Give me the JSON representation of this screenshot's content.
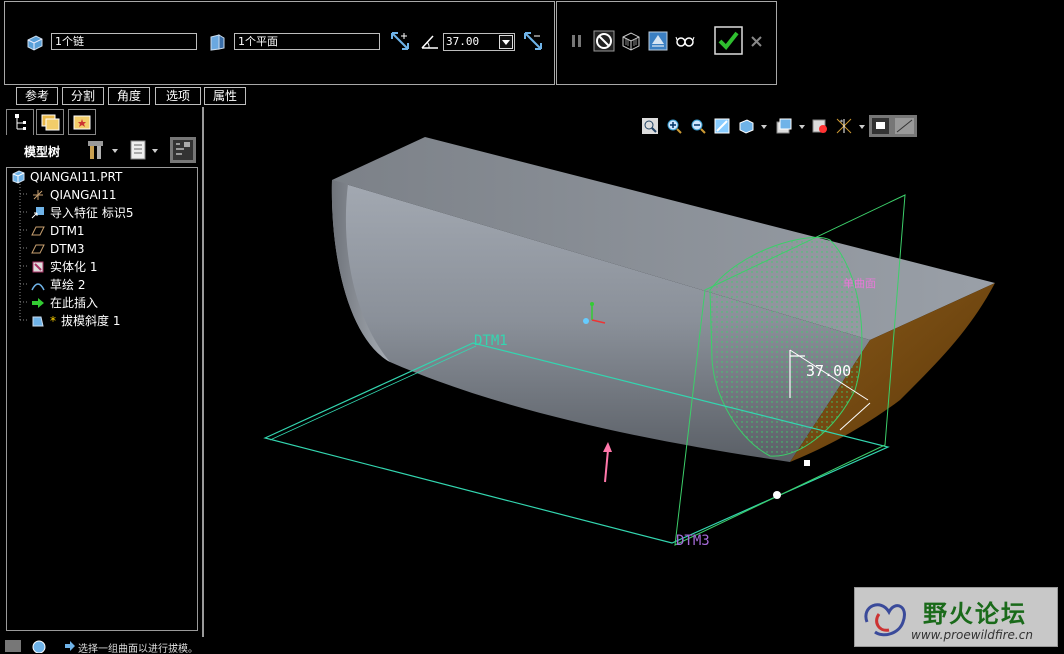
{
  "dashboard": {
    "chain_field": "1个链",
    "plane_field": "1个平面",
    "angle_value": "37.00"
  },
  "tabs": [
    "参考",
    "分割",
    "角度",
    "选项",
    "属性"
  ],
  "model_tree": {
    "title": "模型树",
    "root": "QIANGAI11.PRT",
    "items": [
      {
        "label": "QIANGAI11",
        "icon": "coordinate-system-icon"
      },
      {
        "label": "导入特征 标识5",
        "icon": "import-feature-icon"
      },
      {
        "label": "DTM1",
        "icon": "datum-plane-icon"
      },
      {
        "label": "DTM3",
        "icon": "datum-plane-icon"
      },
      {
        "label": "实体化 1",
        "icon": "solidify-icon"
      },
      {
        "label": "草绘 2",
        "icon": "sketch-icon"
      },
      {
        "label": "在此插入",
        "icon": "insert-here-arrow-icon"
      },
      {
        "label": "拔模斜度 1",
        "icon": "draft-feature-icon"
      }
    ]
  },
  "viewport": {
    "datum_labels": [
      "DTM1",
      "DTM3"
    ],
    "split_surface_label": "单曲面",
    "dimension_label": "37.00"
  },
  "status": {
    "message": "选择一组曲面以进行拔模。"
  },
  "watermark": {
    "brand": "野火论坛",
    "url": "www.proewildfire.cn"
  },
  "colors": {
    "background": "#000000",
    "model_body": "#8a9099",
    "cut_face": "#7a4a10",
    "datum_plane": "#33d6b0",
    "dtm3_plane": "#3ccf6a",
    "confirm_green": "#2fbf2f"
  }
}
